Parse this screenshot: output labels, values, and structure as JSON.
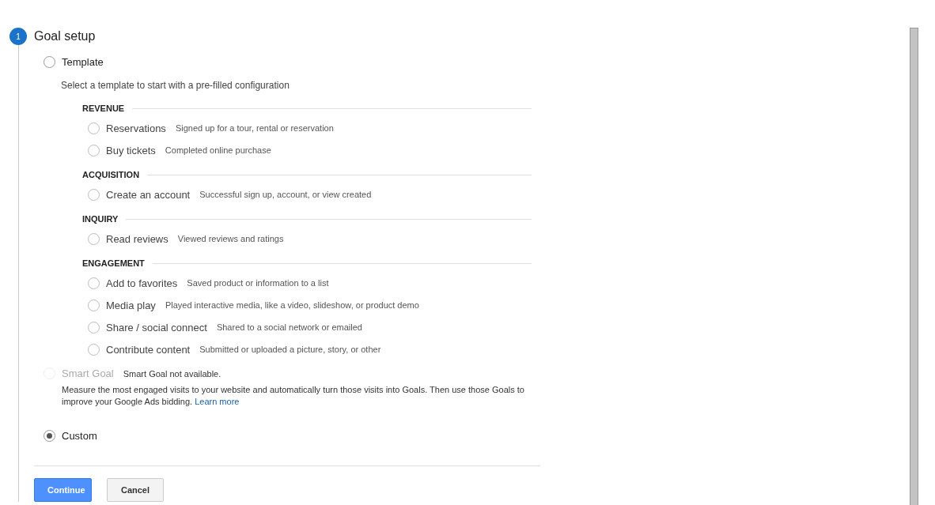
{
  "step": {
    "number": "1",
    "title": "Goal setup"
  },
  "options": [
    {
      "label": "Template",
      "selected": false,
      "disabled": false,
      "description": "Select a template to start with a pre-filled configuration",
      "categories": [
        {
          "name": "REVENUE",
          "items": [
            {
              "label": "Reservations",
              "hint": "Signed up for a tour, rental or reservation",
              "selected": false
            },
            {
              "label": "Buy tickets",
              "hint": "Completed online purchase",
              "selected": false
            }
          ]
        },
        {
          "name": "ACQUISITION",
          "items": [
            {
              "label": "Create an account",
              "hint": "Successful sign up, account, or view created",
              "selected": false
            }
          ]
        },
        {
          "name": "INQUIRY",
          "items": [
            {
              "label": "Read reviews",
              "hint": "Viewed reviews and ratings",
              "selected": false
            }
          ]
        },
        {
          "name": "ENGAGEMENT",
          "items": [
            {
              "label": "Add to favorites",
              "hint": "Saved product or information to a list",
              "selected": false
            },
            {
              "label": "Media play",
              "hint": "Played interactive media, like a video, slideshow, or product demo",
              "selected": false
            },
            {
              "label": "Share / social connect",
              "hint": "Shared to a social network or emailed",
              "selected": false
            },
            {
              "label": "Contribute content",
              "hint": "Submitted or uploaded a picture, story, or other",
              "selected": false
            }
          ]
        }
      ]
    },
    {
      "label": "Smart Goal",
      "selected": false,
      "disabled": true,
      "note": "Smart Goal not available.",
      "description": "Measure the most engaged visits to your website and automatically turn those visits into Goals. Then use those Goals to improve your Google Ads bidding.",
      "link": "Learn more"
    },
    {
      "label": "Custom",
      "selected": true,
      "disabled": false
    }
  ],
  "buttons": [
    {
      "label": "Continue",
      "kind": "primary"
    },
    {
      "label": "Cancel",
      "kind": "secondary"
    }
  ]
}
